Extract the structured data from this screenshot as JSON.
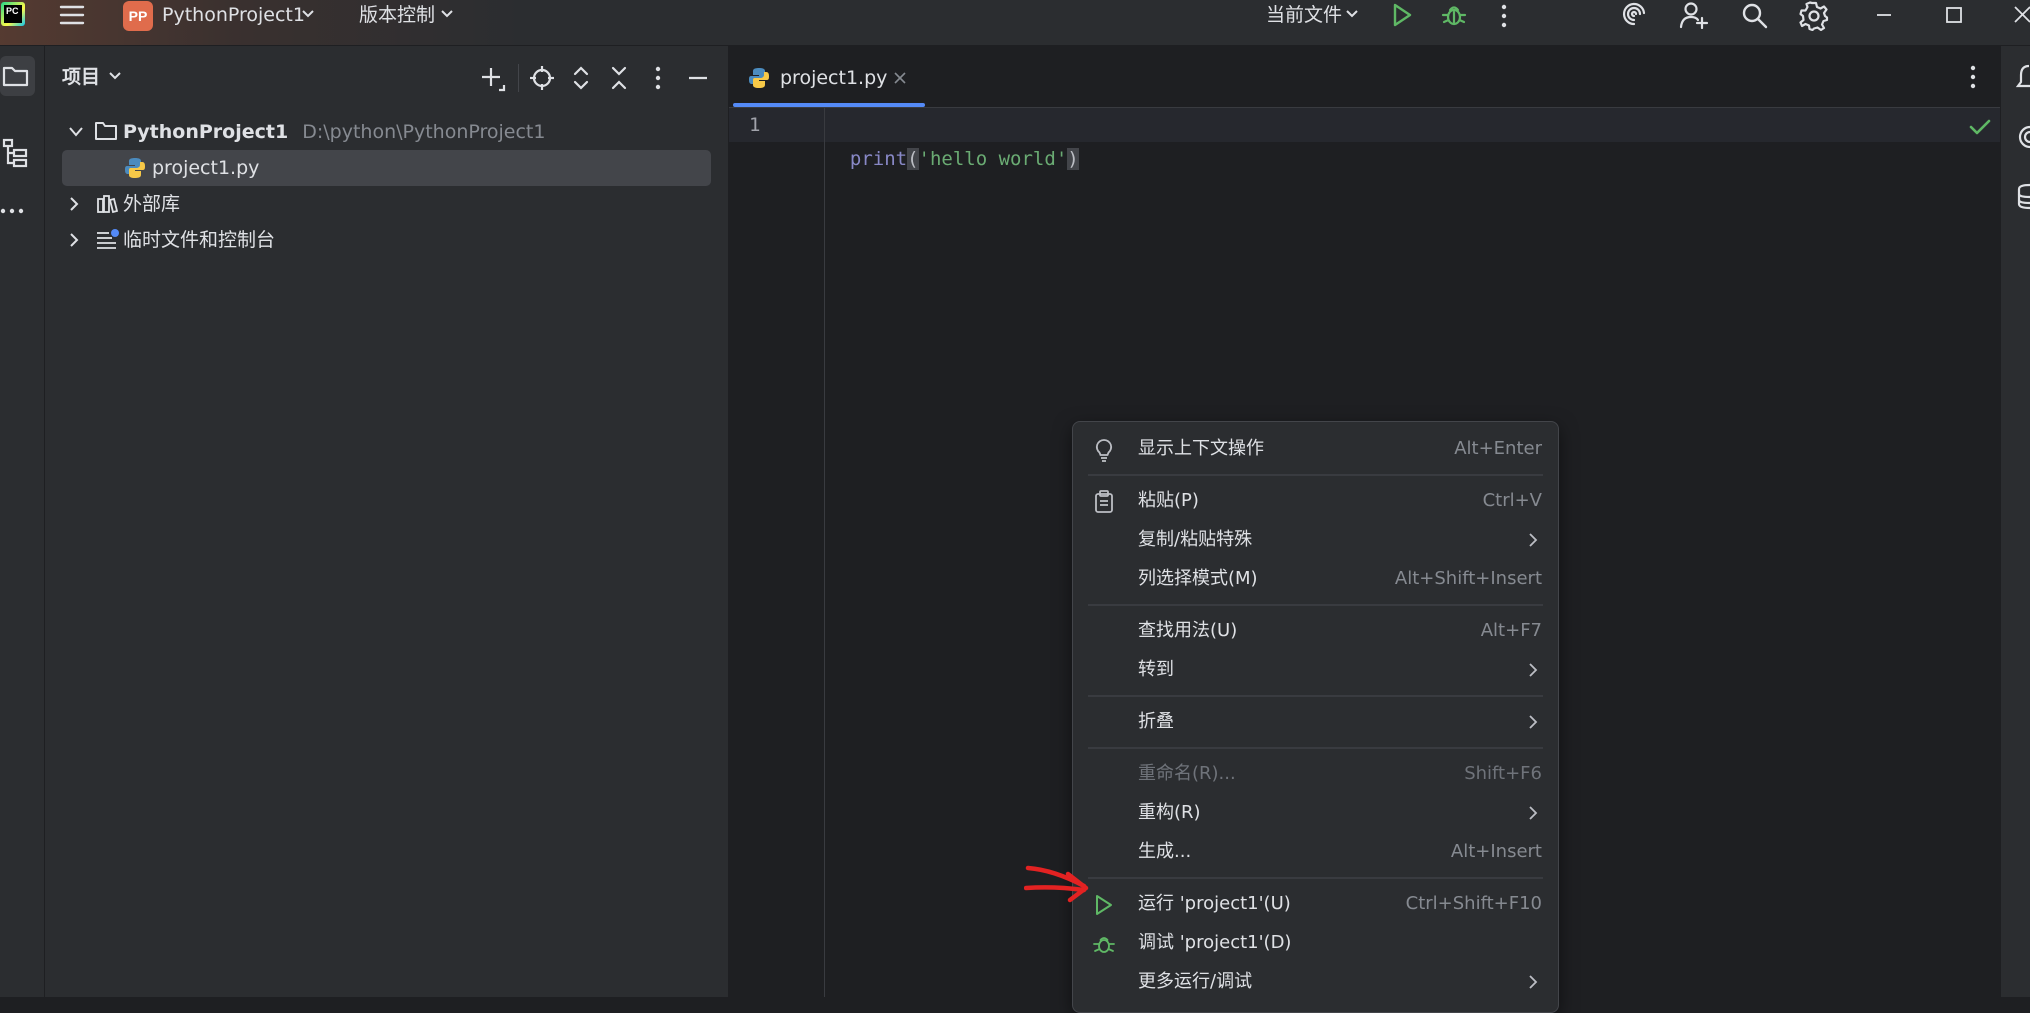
{
  "app": {
    "logo_text": "PC",
    "project_badge": "PP",
    "project_name": "PythonProject1",
    "vcs_label": "版本控制",
    "run_config": "当前文件"
  },
  "project_panel": {
    "title": "项目",
    "tree": {
      "root_name": "PythonProject1",
      "root_path": "D:\\python\\PythonProject1",
      "file": "project1.py",
      "external_libs": "外部库",
      "scratches": "临时文件和控制台"
    }
  },
  "editor": {
    "tab_label": "project1.py",
    "line_number": "1",
    "code": {
      "fn": "print",
      "open": "(",
      "str": "'hello world'",
      "close": ")"
    }
  },
  "context_menu": {
    "items": [
      {
        "label": "显示上下文操作",
        "shortcut": "Alt+Enter"
      },
      {
        "label": "粘贴(P)",
        "shortcut": "Ctrl+V"
      },
      {
        "label": "复制/粘贴特殊",
        "shortcut": ""
      },
      {
        "label": "列选择模式(M)",
        "shortcut": "Alt+Shift+Insert"
      },
      {
        "label": "查找用法(U)",
        "shortcut": "Alt+F7"
      },
      {
        "label": "转到",
        "shortcut": ""
      },
      {
        "label": "折叠",
        "shortcut": ""
      },
      {
        "label": "重命名(R)...",
        "shortcut": "Shift+F6"
      },
      {
        "label": "重构(R)",
        "shortcut": ""
      },
      {
        "label": "生成...",
        "shortcut": "Alt+Insert"
      },
      {
        "label": "运行 'project1'(U)",
        "shortcut": "Ctrl+Shift+F10"
      },
      {
        "label": "调试 'project1'(D)",
        "shortcut": ""
      },
      {
        "label": "更多运行/调试",
        "shortcut": ""
      }
    ]
  },
  "colors": {
    "accent": "#548af7",
    "run_green": "#5fb865",
    "annotation_red": "#e32222",
    "string_green": "#6aab73",
    "builtin_purple": "#8888c6"
  }
}
